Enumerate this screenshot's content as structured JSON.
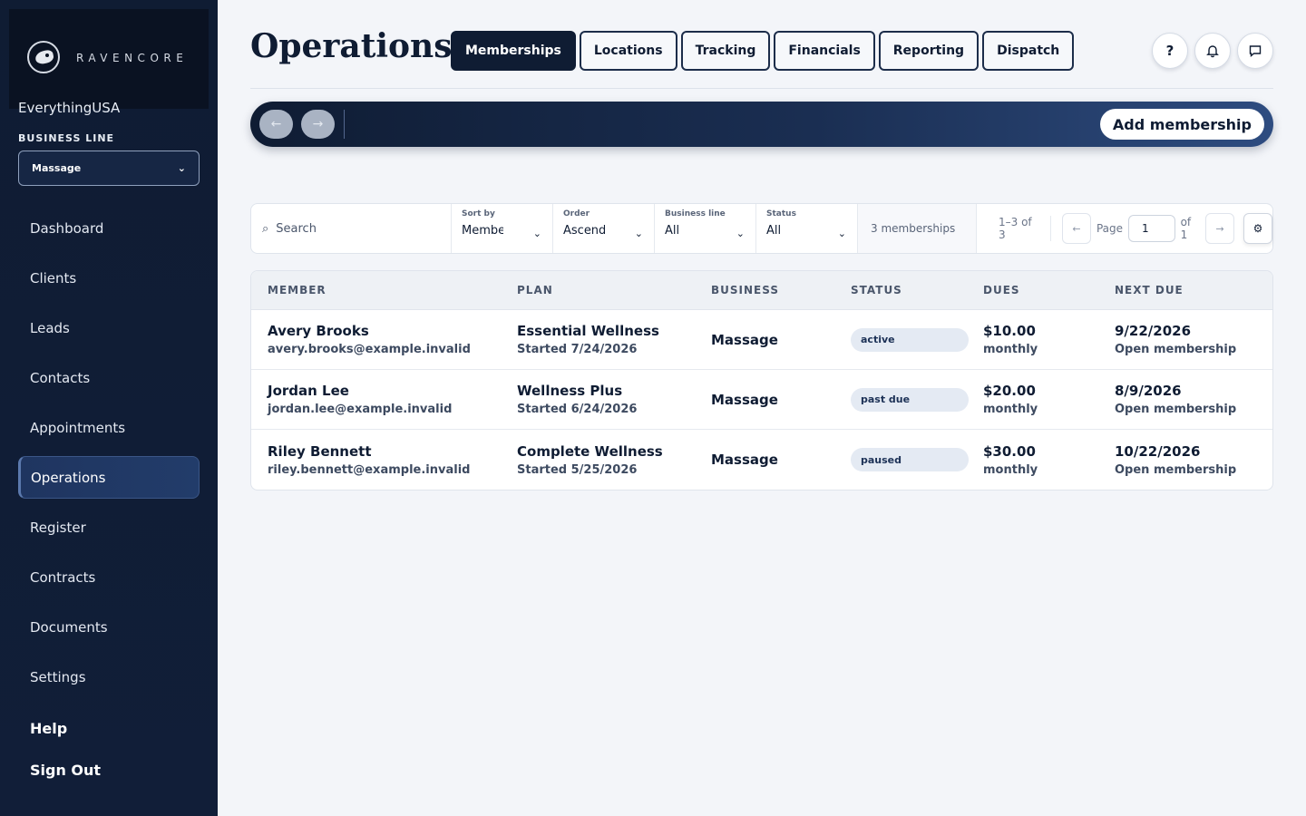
{
  "brand": {
    "logo_text": "RAVENCORE",
    "org_name": "EverythingUSA"
  },
  "business_line": {
    "label": "BUSINESS LINE",
    "value": "Massage"
  },
  "nav": {
    "items": [
      {
        "label": "Dashboard"
      },
      {
        "label": "Clients"
      },
      {
        "label": "Leads"
      },
      {
        "label": "Contacts"
      },
      {
        "label": "Appointments"
      },
      {
        "label": "Operations"
      },
      {
        "label": "Register"
      },
      {
        "label": "Contracts"
      },
      {
        "label": "Documents"
      },
      {
        "label": "Settings"
      }
    ],
    "active": "Operations",
    "help": "Help",
    "sign_out": "Sign Out"
  },
  "header": {
    "title": "Operations",
    "tabs": [
      {
        "label": "Memberships"
      },
      {
        "label": "Locations"
      },
      {
        "label": "Tracking"
      },
      {
        "label": "Financials"
      },
      {
        "label": "Reporting"
      },
      {
        "label": "Dispatch"
      }
    ],
    "help_icon_label": "?"
  },
  "toolbar": {
    "back": "←",
    "forward": "→",
    "add_label": "Add membership"
  },
  "filters": {
    "search_placeholder": "Search",
    "sort_by": {
      "label": "Sort by",
      "value": "Member"
    },
    "order": {
      "label": "Order",
      "value": "Ascending"
    },
    "business_line": {
      "label": "Business line",
      "value": "All"
    },
    "status": {
      "label": "Status",
      "value": "All"
    },
    "count": "3 memberships",
    "range": "1–3 of 3",
    "page_label": "Page",
    "page_value": "1",
    "of_label": "of 1",
    "prev": "←",
    "next": "→"
  },
  "table": {
    "headers": [
      "MEMBER",
      "PLAN",
      "BUSINESS",
      "STATUS",
      "DUES",
      "NEXT DUE"
    ],
    "rows": [
      {
        "name": "Avery Brooks",
        "email": "avery.brooks@example.invalid",
        "plan": "Essential Wellness",
        "started": "Started 7/24/2026",
        "business": "Massage",
        "status": "active",
        "dues": "$10.00",
        "period": "monthly",
        "next_due": "9/22/2026",
        "next_sub": "Open membership"
      },
      {
        "name": "Jordan Lee",
        "email": "jordan.lee@example.invalid",
        "plan": "Wellness Plus",
        "started": "Started 6/24/2026",
        "business": "Massage",
        "status": "past due",
        "dues": "$20.00",
        "period": "monthly",
        "next_due": "8/9/2026",
        "next_sub": "Open membership"
      },
      {
        "name": "Riley Bennett",
        "email": "riley.bennett@example.invalid",
        "plan": "Complete Wellness",
        "started": "Started 5/25/2026",
        "business": "Massage",
        "status": "paused",
        "dues": "$30.00",
        "period": "monthly",
        "next_due": "10/22/2026",
        "next_sub": "Open membership"
      }
    ]
  },
  "colors": {
    "sidebar": "#0f1c33",
    "accent": "#1f3560",
    "badge_bg": "#e4eaf3"
  }
}
